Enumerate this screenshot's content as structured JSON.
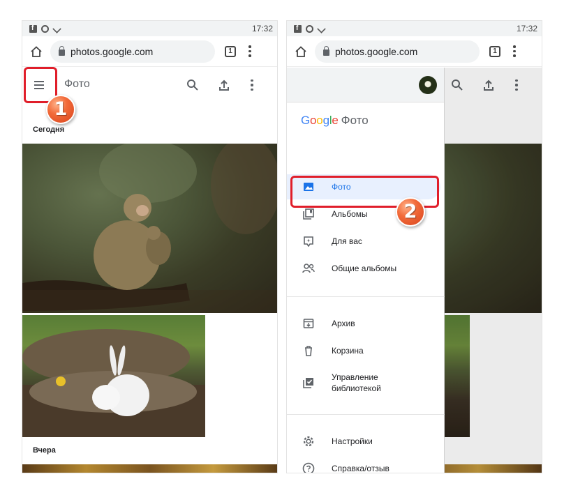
{
  "status_bar": {
    "time": "17:32"
  },
  "browser": {
    "url": "photos.google.com",
    "tab_count": "1"
  },
  "app": {
    "title": "Фото",
    "sections": {
      "today": "Сегодня",
      "yesterday": "Вчера"
    }
  },
  "drawer": {
    "brand": {
      "letters": [
        {
          "char": "G",
          "color": "#4285F4"
        },
        {
          "char": "o",
          "color": "#EA4335"
        },
        {
          "char": "o",
          "color": "#FBBC05"
        },
        {
          "char": "g",
          "color": "#4285F4"
        },
        {
          "char": "l",
          "color": "#34A853"
        },
        {
          "char": "e",
          "color": "#EA4335"
        }
      ],
      "product": "Фото"
    },
    "items": [
      {
        "label": "Фото",
        "icon": "photo-icon",
        "active": true
      },
      {
        "label": "Альбомы",
        "icon": "album-icon"
      },
      {
        "label": "Для вас",
        "icon": "for-you-icon"
      },
      {
        "label": "Общие альбомы",
        "icon": "shared-icon"
      },
      {
        "label": "Архив",
        "icon": "archive-icon"
      },
      {
        "label": "Корзина",
        "icon": "trash-icon"
      },
      {
        "label": "Управление\nбиблиотекой",
        "icon": "library-icon"
      },
      {
        "label": "Настройки",
        "icon": "settings-icon"
      },
      {
        "label": "Справка/отзыв",
        "icon": "help-icon"
      }
    ]
  },
  "callouts": {
    "step1": "1",
    "step2": "2"
  },
  "colors": {
    "accent": "#1a73e8",
    "callout_border": "#e01e2a",
    "callout_badge": "#f26b3a"
  }
}
